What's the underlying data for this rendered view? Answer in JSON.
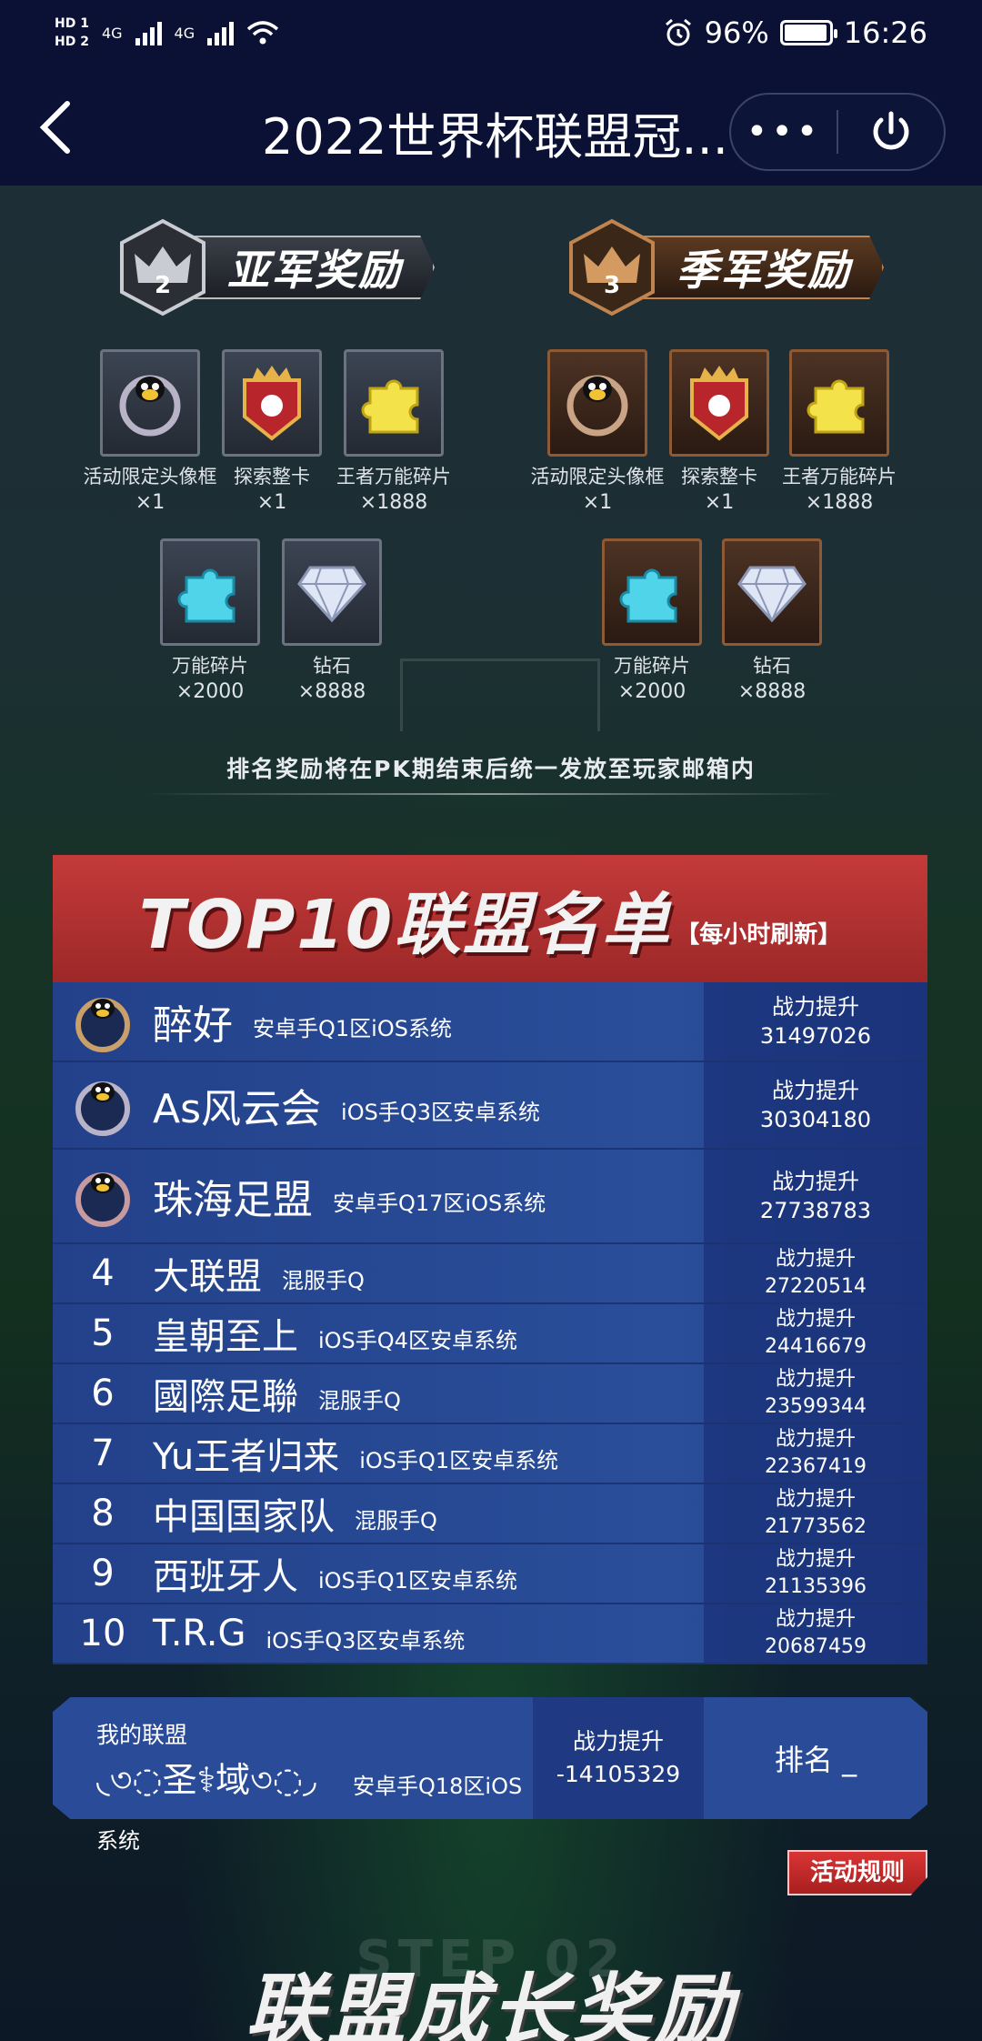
{
  "status_bar": {
    "hd1": "HD 1",
    "hd2": "HD 2",
    "net1": "4G",
    "net2": "4G",
    "battery_pct": "96%",
    "battery_level": 0.96,
    "time": "16:26"
  },
  "nav": {
    "title": "2022世界杯联盟冠...",
    "more_label": "•••"
  },
  "rewards": {
    "silver": {
      "rank": "2",
      "title": "亚军奖励",
      "items": [
        {
          "icon": "avatar-frame-icon",
          "name": "活动限定头像框",
          "qty": "×1"
        },
        {
          "icon": "explore-card-icon",
          "name": "探索整卡",
          "qty": "×1"
        },
        {
          "icon": "gold-puzzle-icon",
          "name": "王者万能碎片",
          "qty": "×1888"
        },
        {
          "icon": "blue-puzzle-icon",
          "name": "万能碎片",
          "qty": "×2000"
        },
        {
          "icon": "diamond-icon",
          "name": "钻石",
          "qty": "×8888"
        }
      ]
    },
    "bronze": {
      "rank": "3",
      "title": "季军奖励",
      "items": [
        {
          "icon": "avatar-frame-icon",
          "name": "活动限定头像框",
          "qty": "×1"
        },
        {
          "icon": "explore-card-icon",
          "name": "探索整卡",
          "qty": "×1"
        },
        {
          "icon": "gold-puzzle-icon",
          "name": "王者万能碎片",
          "qty": "×1888"
        },
        {
          "icon": "blue-puzzle-icon",
          "name": "万能碎片",
          "qty": "×2000"
        },
        {
          "icon": "diamond-icon",
          "name": "钻石",
          "qty": "×8888"
        }
      ]
    },
    "notice": "排名奖励将在PK期结束后统一发放至玩家邮箱内"
  },
  "top10": {
    "title": "TOP10联盟名单",
    "subtitle": "【每小时刷新】",
    "power_label": "战力提升",
    "rows": [
      {
        "rank": "",
        "name": "醉好",
        "zone": "安卓手Q1区iOS系统",
        "power": "31497026"
      },
      {
        "rank": "",
        "name": "As风云会",
        "zone": "iOS手Q3区安卓系统",
        "power": "30304180"
      },
      {
        "rank": "",
        "name": "珠海足盟",
        "zone": "安卓手Q17区iOS系统",
        "power": "27738783"
      },
      {
        "rank": "4",
        "name": "大联盟",
        "zone": "混服手Q",
        "power": "27220514"
      },
      {
        "rank": "5",
        "name": "皇朝至上",
        "zone": "iOS手Q4区安卓系统",
        "power": "24416679"
      },
      {
        "rank": "6",
        "name": "國際足聯",
        "zone": "混服手Q",
        "power": "23599344"
      },
      {
        "rank": "7",
        "name": "Yu王者归来",
        "zone": "iOS手Q1区安卓系统",
        "power": "22367419"
      },
      {
        "rank": "8",
        "name": "中国国家队",
        "zone": "混服手Q",
        "power": "21773562"
      },
      {
        "rank": "9",
        "name": "西班牙人",
        "zone": "iOS手Q1区安卓系统",
        "power": "21135396"
      },
      {
        "rank": "10",
        "name": "T.R.G",
        "zone": "iOS手Q3区安卓系统",
        "power": "20687459"
      }
    ]
  },
  "my_alliance": {
    "label": "我的联盟",
    "name": "◟৩◌圣⚕域৩◌◞",
    "zone_part1": "安卓手Q18区iOS",
    "zone_part2": "系统",
    "power_label": "战力提升",
    "power": "-14105329",
    "rank_label": "排名 _"
  },
  "rules_button": "活动规则",
  "growth_bg": "STEP 02",
  "growth_title": "联盟成长奖励",
  "colors": {
    "nav_bg": "#0a1135",
    "top10_header": "#c43a3a",
    "row_blue": "#2a4e9a"
  }
}
